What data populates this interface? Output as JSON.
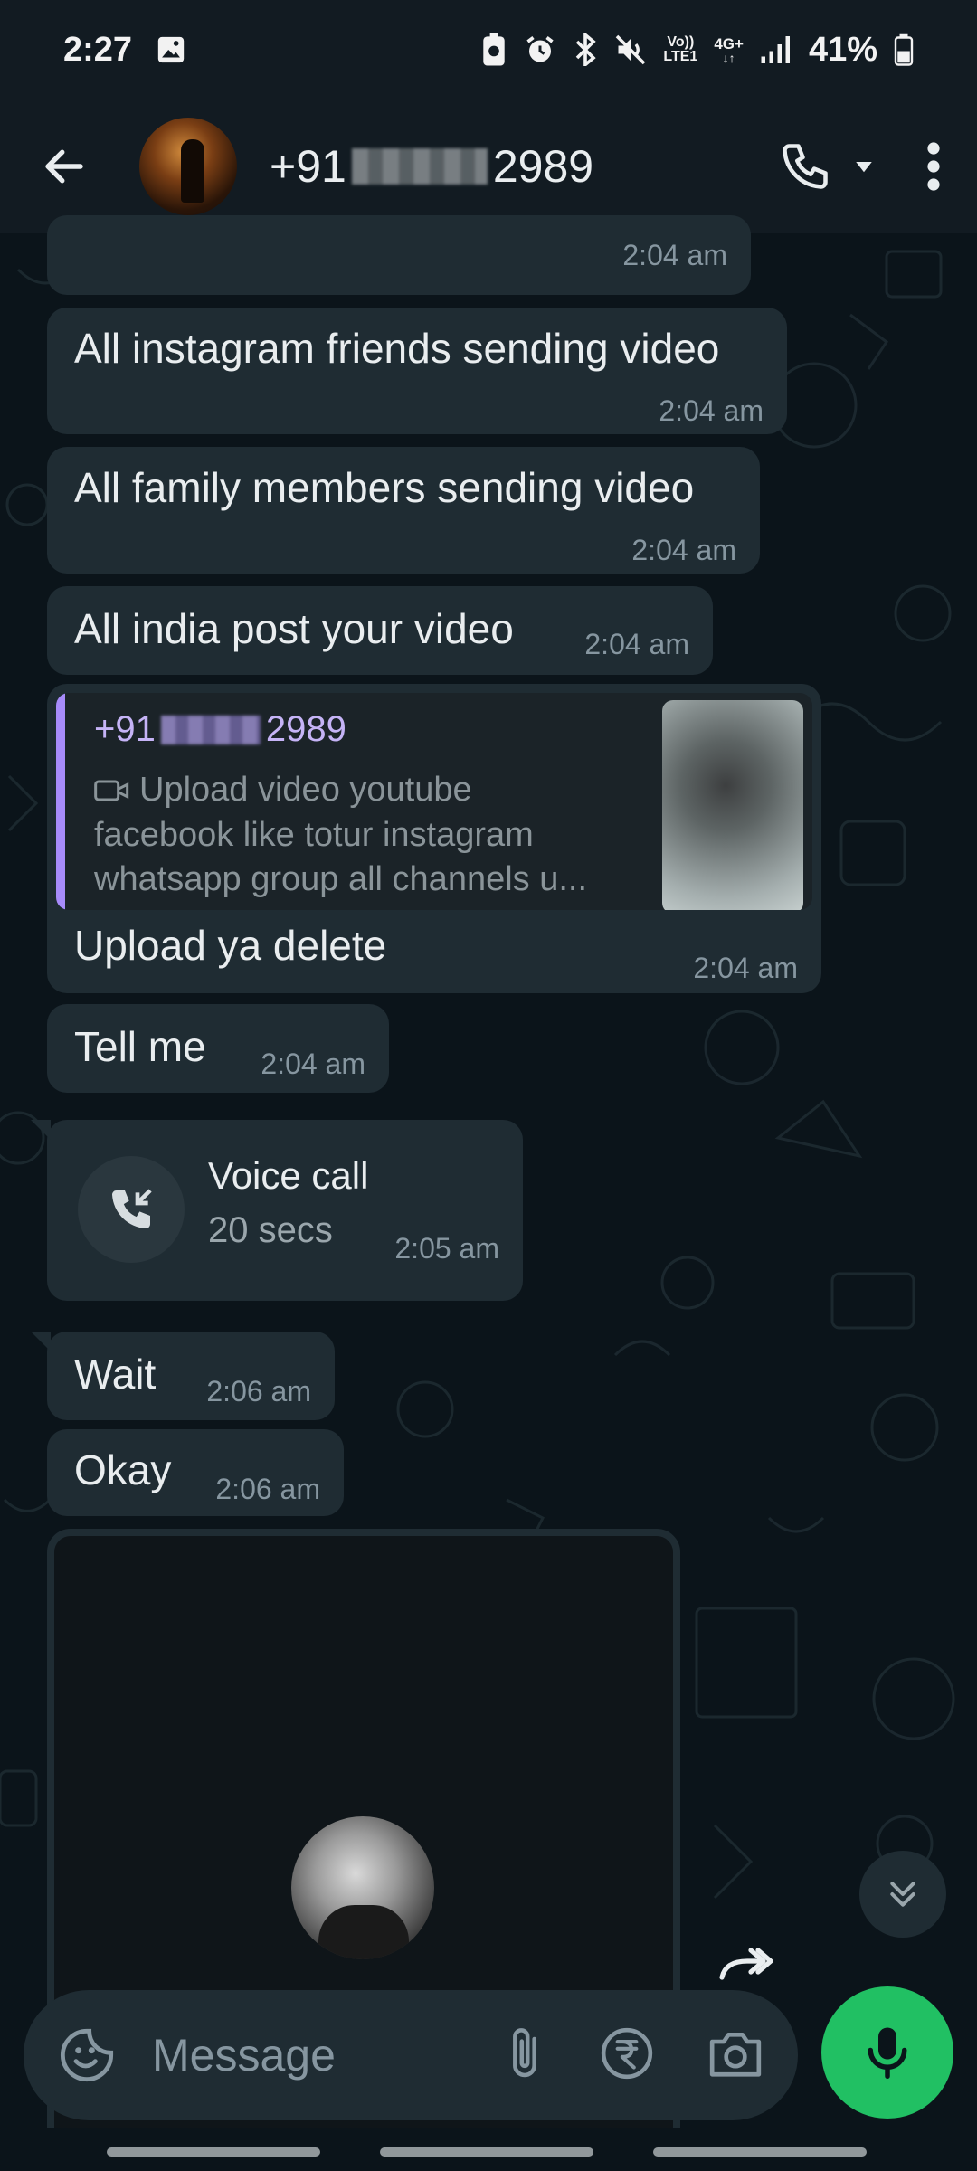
{
  "status_bar": {
    "time": "2:27",
    "network_top": "Vo))",
    "network_bottom": "LTE1",
    "network_type": "4G+",
    "battery": "41%",
    "icons": [
      "gallery-icon",
      "battery-saver-icon",
      "alarm-icon",
      "bluetooth-icon",
      "mute-icon",
      "volte-icon",
      "signal-icon",
      "battery-icon"
    ]
  },
  "header": {
    "contact_prefix": "+91",
    "contact_suffix": "2989",
    "icons": [
      "back-arrow-icon",
      "phone-icon",
      "dropdown-icon",
      "more-vertical-icon"
    ]
  },
  "messages": [
    {
      "id": "m0",
      "text": "",
      "time": "2:04 am"
    },
    {
      "id": "m1",
      "text": "All instagram friends sending video",
      "time": "2:04 am"
    },
    {
      "id": "m2",
      "text": "All family members sending video",
      "time": "2:04 am"
    },
    {
      "id": "m3",
      "text": "All india post your video",
      "time": "2:04 am"
    },
    {
      "id": "m4",
      "reply": {
        "name_prefix": "+91",
        "name_suffix": "2989",
        "lines": [
          "Upload video youtube",
          "facebook like totur instagram",
          "whatsapp group all channels u..."
        ],
        "media_icon": "video-camera-icon"
      },
      "text": "Upload ya delete",
      "time": "2:04 am"
    },
    {
      "id": "m5",
      "text": "Tell me",
      "time": "2:04 am"
    },
    {
      "id": "m6",
      "call_title": "Voice call",
      "call_duration": "20 secs",
      "time": "2:05 am",
      "icon": "missed-call-icon"
    },
    {
      "id": "m7",
      "text": "Wait",
      "time": "2:06 am"
    },
    {
      "id": "m8",
      "text": "Okay",
      "time": "2:06 am"
    }
  ],
  "composer": {
    "placeholder": "Message",
    "icons": [
      "sticker-icon",
      "attach-icon",
      "rupee-payment-icon",
      "camera-icon",
      "microphone-icon"
    ]
  },
  "floating": {
    "icons": [
      "share-forward-icon",
      "scroll-down-icon"
    ]
  },
  "colors": {
    "background": "#0b141a",
    "header": "#121b22",
    "bubble_incoming": "#1f2c33",
    "accent_green": "#21c063",
    "reply_accent": "#a78bfa",
    "meta_text": "#8696a0"
  }
}
